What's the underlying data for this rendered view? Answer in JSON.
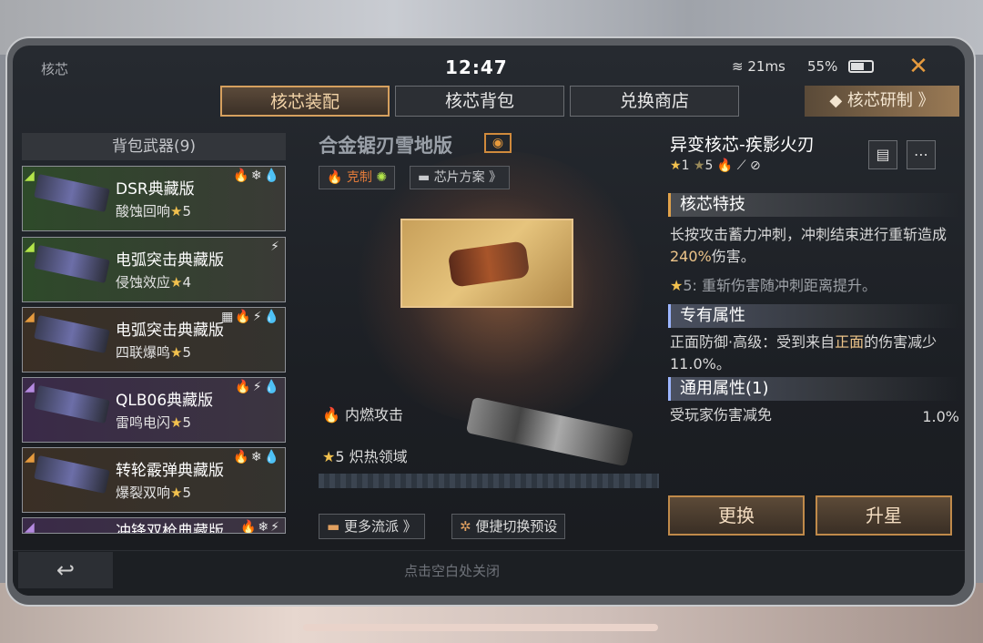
{
  "status": {
    "title": "核芯",
    "time": "12:47",
    "wifi": "21ms",
    "battery": "55%"
  },
  "tabs": [
    {
      "label": "核芯装配",
      "active": true
    },
    {
      "label": "核芯背包",
      "active": false
    },
    {
      "label": "兑换商店",
      "active": false
    }
  ],
  "research_label": "核芯研制 》",
  "left": {
    "header": "背包武器(9)",
    "weapons": [
      {
        "name": "DSR典藏版",
        "sub": "酸蚀回响",
        "stars": "5",
        "icons": "🔥❄💧"
      },
      {
        "name": "电弧突击典藏版",
        "sub": "侵蚀效应",
        "stars": "4",
        "icons": "⚡"
      },
      {
        "name": "电弧突击典藏版",
        "sub": "四联爆鸣",
        "stars": "5",
        "icons": "▦🔥⚡💧"
      },
      {
        "name": "QLB06典藏版",
        "sub": "雷鸣电闪",
        "stars": "5",
        "icons": "🔥⚡💧"
      },
      {
        "name": "转轮霰弹典藏版",
        "sub": "爆裂双响",
        "stars": "5",
        "icons": "🔥❄💧"
      },
      {
        "name": "冲锋双枪典藏版",
        "sub": "",
        "stars": "",
        "icons": "🔥❄⚡"
      }
    ]
  },
  "center": {
    "title": "合金锯刃雪地版",
    "counter_label": "克制",
    "chip_plan_label": "芯片方案 》",
    "perk1": "内燃攻击",
    "perk2_star": "5",
    "perk2": "炽热领域",
    "more_label": "更多流派 》",
    "switch_label": "便捷切换预设"
  },
  "right": {
    "core_name": "异变核芯-疾影火刃",
    "tags": {
      "star1": "1",
      "star5": "5"
    },
    "sec1": "核芯特技",
    "desc1_a": "长按攻击蓄力冲刺，冲刺结束进行重斩造成",
    "desc1_hl": "240%",
    "desc1_b": "伤害。",
    "note": "5: 重斩伤害随冲刺距离提升。",
    "sec2": "专有属性",
    "desc2_a": "正面防御·高级：受到来自",
    "desc2_hl": "正面",
    "desc2_b": "的伤害减少11.0%。",
    "sec3": "通用属性(1)",
    "attr_name": "受玩家伤害减免",
    "attr_val": "1.0%",
    "btn_replace": "更换",
    "btn_upgrade": "升星"
  },
  "footer_hint": "点击空白处关闭"
}
